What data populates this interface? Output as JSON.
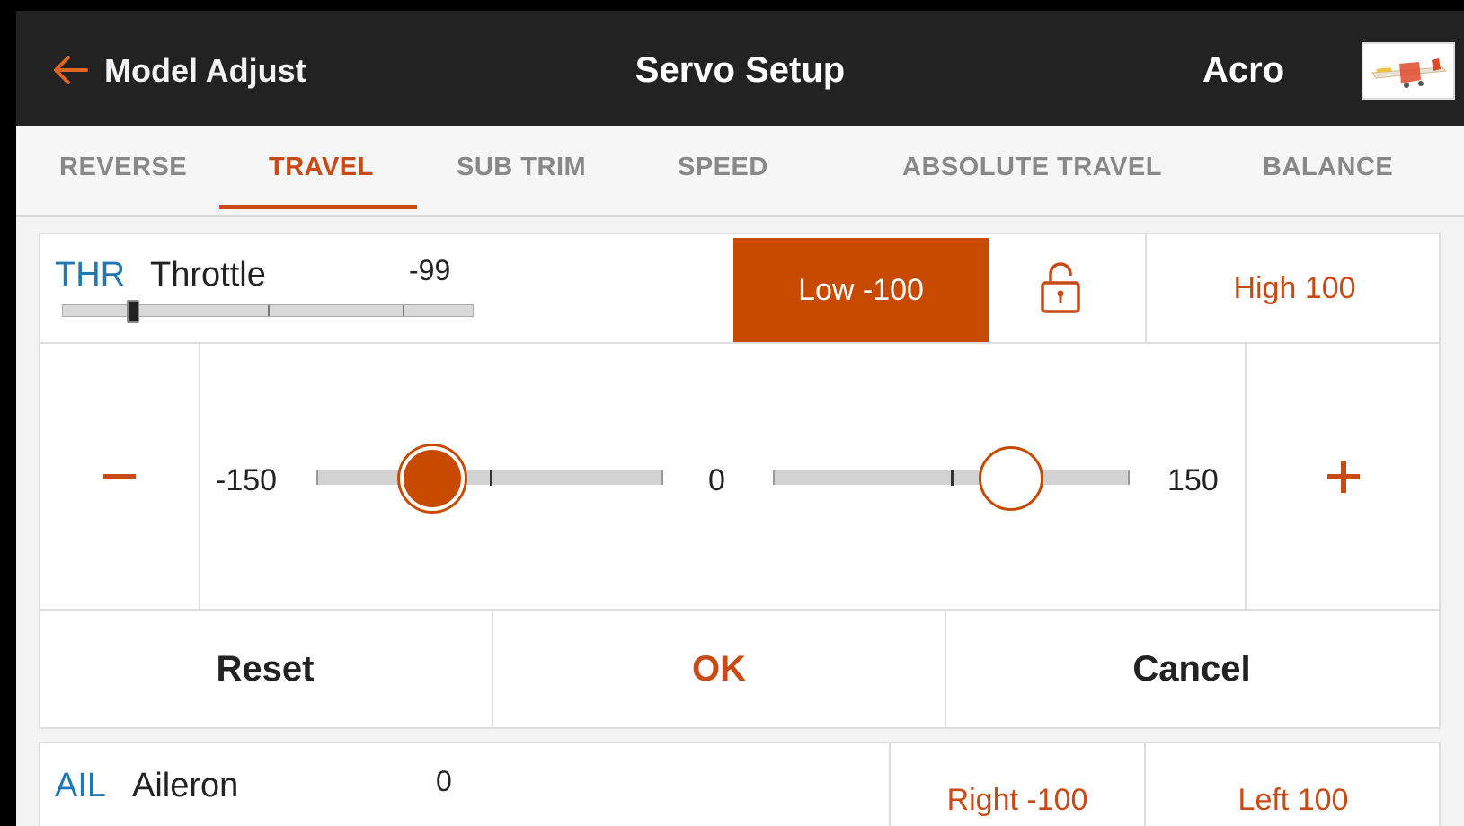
{
  "header": {
    "back_label": "Model Adjust",
    "title": "Servo Setup",
    "model_name": "Acro"
  },
  "tabs": [
    {
      "label": "REVERSE",
      "active": false
    },
    {
      "label": "TRAVEL",
      "active": true
    },
    {
      "label": "SUB TRIM",
      "active": false
    },
    {
      "label": "SPEED",
      "active": false
    },
    {
      "label": "ABSOLUTE TRAVEL",
      "active": false
    },
    {
      "label": "BALANCE",
      "active": false
    }
  ],
  "channel": {
    "abbr": "THR",
    "name": "Throttle",
    "value": "-99",
    "position_value": -99,
    "low_label": "Low -100",
    "high_label": "High 100"
  },
  "editor": {
    "min_label": "-150",
    "mid_label": "0",
    "max_label": "150",
    "low_value": -100,
    "high_value": 100,
    "minus_symbol": "–",
    "plus_symbol": "+"
  },
  "actions": {
    "reset": "Reset",
    "ok": "OK",
    "cancel": "Cancel"
  },
  "channel2": {
    "abbr": "AIL",
    "name": "Aileron",
    "value": "0",
    "right_label": "Right -100",
    "left_label": "Left 100"
  },
  "colors": {
    "accent": "#c84a00",
    "channel_abbr": "#1f78b4",
    "header_bg": "#222222"
  }
}
